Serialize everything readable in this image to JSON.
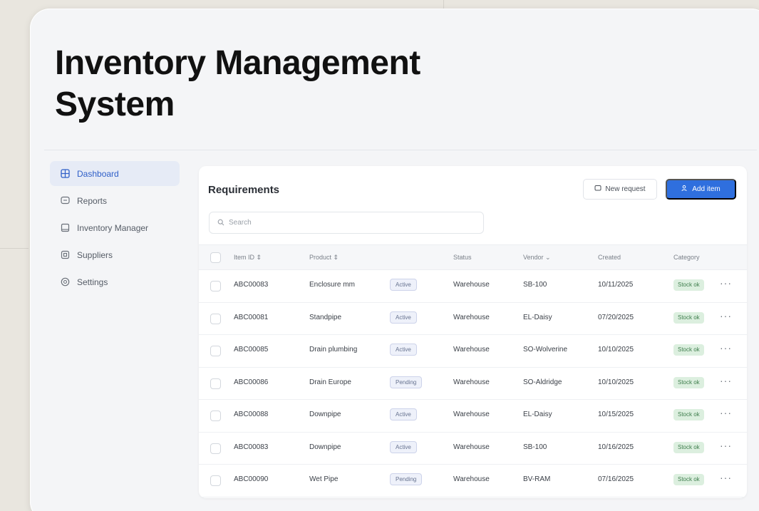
{
  "page": {
    "title": "Inventory Management System"
  },
  "sidebar": {
    "items": [
      {
        "label": "Dashboard",
        "icon": "grid-icon",
        "active": true
      },
      {
        "label": "Reports",
        "icon": "chat-icon",
        "active": false
      },
      {
        "label": "Inventory Manager",
        "icon": "box-icon",
        "active": false
      },
      {
        "label": "Suppliers",
        "icon": "tag-icon",
        "active": false
      },
      {
        "label": "Settings",
        "icon": "gear-icon",
        "active": false
      }
    ]
  },
  "panel": {
    "title": "Requirements",
    "secondary_button": "New request",
    "primary_button": "Add item",
    "search_placeholder": "Search"
  },
  "table": {
    "columns": [
      "Item ID",
      "Product",
      "Status",
      "Vendor",
      "Created",
      "Category"
    ],
    "rows": [
      {
        "id": "ABC00083",
        "product": "Enclosure mm",
        "tag": "Active",
        "status": "Warehouse",
        "vendor": "SB-100",
        "created": "10/11/2025",
        "category": "Stock ok"
      },
      {
        "id": "ABC00081",
        "product": "Standpipe",
        "tag": "Active",
        "status": "Warehouse",
        "vendor": "EL-Daisy",
        "created": "07/20/2025",
        "category": "Stock ok"
      },
      {
        "id": "ABC00085",
        "product": "Drain plumbing",
        "tag": "Active",
        "status": "Warehouse",
        "vendor": "SO-Wolverine",
        "created": "10/10/2025",
        "category": "Stock ok"
      },
      {
        "id": "ABC00086",
        "product": "Drain Europe",
        "tag": "Pending",
        "status": "Warehouse",
        "vendor": "SO-Aldridge",
        "created": "10/10/2025",
        "category": "Stock ok"
      },
      {
        "id": "ABC00088",
        "product": "Downpipe",
        "tag": "Active",
        "status": "Warehouse",
        "vendor": "EL-Daisy",
        "created": "10/15/2025",
        "category": "Stock ok"
      },
      {
        "id": "ABC00083",
        "product": "Downpipe",
        "tag": "Active",
        "status": "Warehouse",
        "vendor": "SB-100",
        "created": "10/16/2025",
        "category": "Stock ok"
      },
      {
        "id": "ABC00090",
        "product": "Wet Pipe",
        "tag": "Pending",
        "status": "Warehouse",
        "vendor": "BV-RAM",
        "created": "07/16/2025",
        "category": "Stock ok"
      }
    ],
    "more_glyph": "···"
  },
  "colors": {
    "accent": "#2f6fde",
    "active_nav_bg": "#e6ebf6",
    "status_green": "#3f7e4d"
  }
}
